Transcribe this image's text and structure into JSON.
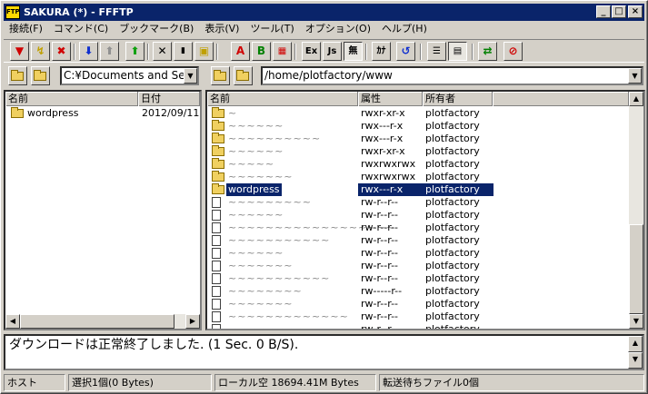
{
  "window": {
    "title": "SAKURA (*) - FFFTP",
    "app_icon_text": "FTP"
  },
  "window_buttons": {
    "minimize": "_",
    "maximize": "□",
    "close": "×"
  },
  "menu": [
    "接続(F)",
    "コマンド(C)",
    "ブックマーク(B)",
    "表示(V)",
    "ツール(T)",
    "オプション(O)",
    "ヘルプ(H)"
  ],
  "toolbar_icons": {
    "connect": "connect-icon",
    "quick_connect": "quick-connect-icon",
    "disconnect": "disconnect-icon",
    "download": "download-icon",
    "upload": "upload-icon",
    "mirror_upload": "mirror-upload-icon",
    "delete": "delete-icon",
    "rename": "rename-icon",
    "mkdir": "mkdir-icon",
    "mode_ascii": "A",
    "mode_binary": "B",
    "mode_auto": "auto-mode-icon",
    "case_ex": "Ex",
    "case_js": "Js",
    "case_none": "無",
    "kana": "ｶﾅ",
    "refresh": "refresh-icon",
    "list_view": "list-view-icon",
    "detail_view": "detail-view-icon",
    "sync": "sync-icon",
    "stop": "stop-icon"
  },
  "local": {
    "path": "C:¥Documents and Set",
    "columns": {
      "name": "名前",
      "date": "日付"
    },
    "items": [
      {
        "name": "wordpress",
        "date": "2012/09/11",
        "type": "folder"
      }
    ]
  },
  "remote": {
    "path": "/home/plotfactory/www",
    "columns": {
      "name": "名前",
      "perm": "属性",
      "owner": "所有者"
    },
    "items": [
      {
        "name": "~",
        "perm": "rwxr-xr-x",
        "owner": "plotfactory",
        "type": "folder",
        "obscured": true
      },
      {
        "name": "~~~~~~",
        "perm": "rwx---r-x",
        "owner": "plotfactory",
        "type": "folder",
        "obscured": true
      },
      {
        "name": "~~~~~~~~~~",
        "perm": "rwx---r-x",
        "owner": "plotfactory",
        "type": "folder",
        "obscured": true
      },
      {
        "name": "~~~~~~",
        "perm": "rwxr-xr-x",
        "owner": "plotfactory",
        "type": "folder",
        "obscured": true
      },
      {
        "name": "~~~~~",
        "perm": "rwxrwxrwx",
        "owner": "plotfactory",
        "type": "folder",
        "obscured": true
      },
      {
        "name": "~~~~~~~",
        "perm": "rwxrwxrwx",
        "owner": "plotfactory",
        "type": "folder",
        "obscured": true
      },
      {
        "name": "wordpress",
        "perm": "rwx---r-x",
        "owner": "plotfactory",
        "type": "folder",
        "selected": true
      },
      {
        "name": "~~~~~~~~~",
        "perm": "rw-r--r--",
        "owner": "plotfactory",
        "type": "file",
        "obscured": true
      },
      {
        "name": "~~~~~~",
        "perm": "rw-r--r--",
        "owner": "plotfactory",
        "type": "file",
        "obscured": true
      },
      {
        "name": "~~~~~~~~~~~~~~~~~~",
        "perm": "rw-r--r--",
        "owner": "plotfactory",
        "type": "file",
        "obscured": true
      },
      {
        "name": "~~~~~~~~~~~",
        "perm": "rw-r--r--",
        "owner": "plotfactory",
        "type": "file",
        "obscured": true
      },
      {
        "name": "~~~~~~",
        "perm": "rw-r--r--",
        "owner": "plotfactory",
        "type": "file",
        "obscured": true
      },
      {
        "name": "~~~~~~~",
        "perm": "rw-r--r--",
        "owner": "plotfactory",
        "type": "file",
        "obscured": true
      },
      {
        "name": "~~~~~~~~~~~",
        "perm": "rw-r--r--",
        "owner": "plotfactory",
        "type": "file",
        "obscured": true
      },
      {
        "name": "~~~~~~~~",
        "perm": "rw-----r--",
        "owner": "plotfactory",
        "type": "file",
        "obscured": true
      },
      {
        "name": "~~~~~~~",
        "perm": "rw-r--r--",
        "owner": "plotfactory",
        "type": "file",
        "obscured": true
      },
      {
        "name": "~~~~~~~~~~~~~",
        "perm": "rw-r--r--",
        "owner": "plotfactory",
        "type": "file",
        "obscured": true
      },
      {
        "name": "~~~~~~~~",
        "perm": "rw-r--r--",
        "owner": "plotfactory",
        "type": "file",
        "obscured": true
      }
    ]
  },
  "log": {
    "message": "ダウンロードは正常終了しました. (1 Sec. 0 B/S)."
  },
  "status": {
    "host": "ホスト",
    "selection": "選択1個(0 Bytes)",
    "local_free": "ローカル空 18694.41M Bytes",
    "queue": "転送待ちファイル0個"
  },
  "colors": {
    "selection": "#0a246a",
    "titlebar": "#0a246a",
    "face": "#d4d0c8"
  }
}
